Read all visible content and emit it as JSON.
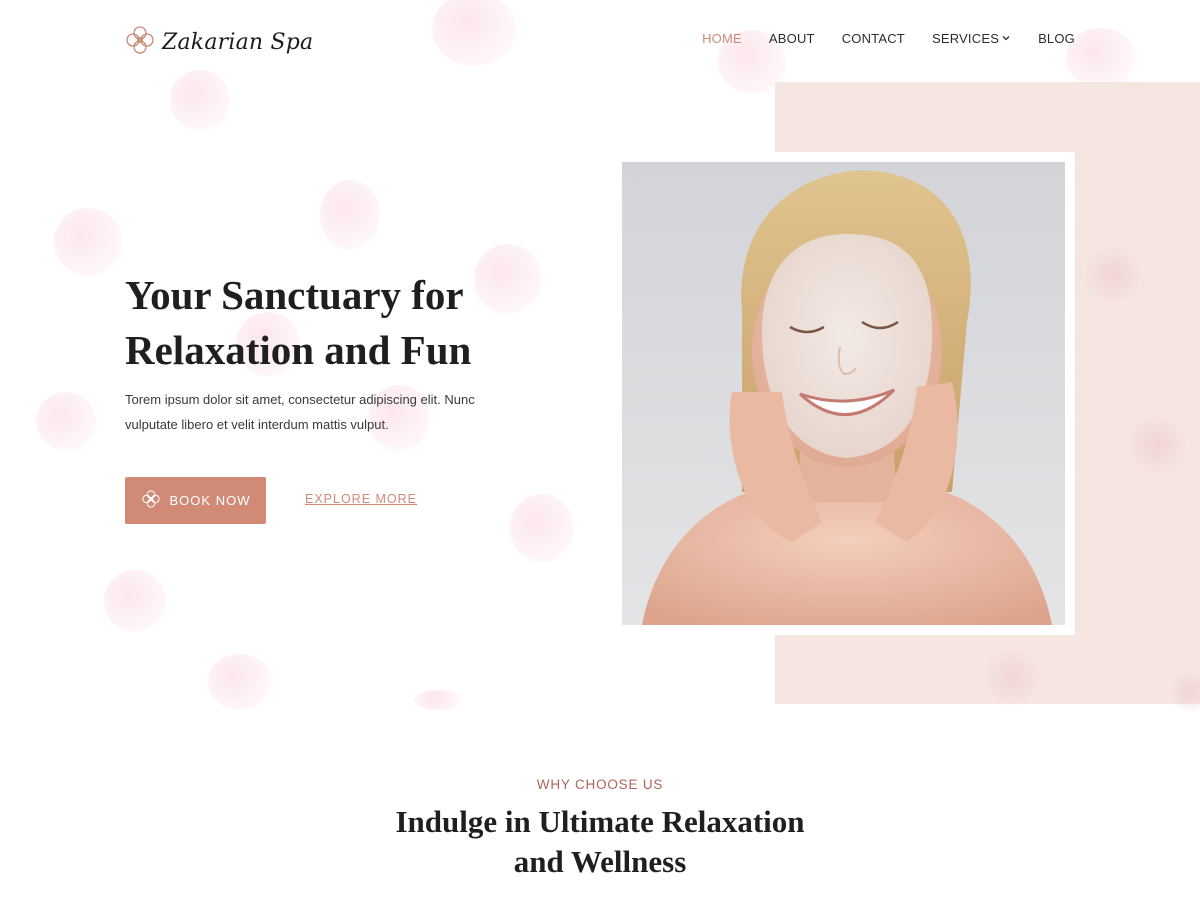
{
  "brand": {
    "name": "Zakarian Spa",
    "accent": "#d18a76",
    "pink_bg": "#f6e6e2"
  },
  "nav": {
    "home": "HOME",
    "about": "ABOUT",
    "contact": "CONTACT",
    "services": "SERVICES",
    "blog": "BLOG",
    "active": "HOME"
  },
  "hero": {
    "title_line1": "Your Sanctuary for",
    "title_line2": "Relaxation and Fun",
    "subtitle": "Torem ipsum dolor sit amet, consectetur adipiscing elit. Nunc vulputate libero et velit interdum mattis vulput.",
    "book_label": "BOOK NOW",
    "explore_label": "EXPLORE MORE"
  },
  "why": {
    "label": "WHY CHOOSE US",
    "title_line1": "Indulge in Ultimate Relaxation",
    "title_line2": "and Wellness"
  },
  "icons": {
    "logo": "flower-icon",
    "book": "flower-icon",
    "services_dropdown": "chevron-down-icon"
  }
}
